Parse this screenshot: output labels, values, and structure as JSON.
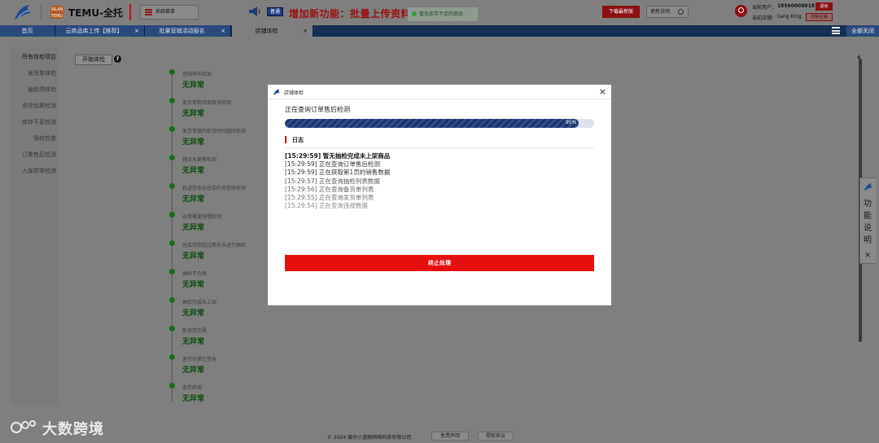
{
  "header": {
    "app_title": "TEMU-全托",
    "temu_badge": "SILAN TEMU",
    "menu_label": "系统菜单",
    "announce_tag": "普通",
    "announcement": "增加新功能：批量上传资料",
    "toast": "暂无库存不足的商品",
    "download_label": "下载最新版",
    "notes_label": "更新说明",
    "user_label": "当前用户：",
    "user_value": "18560008818",
    "store_label": "当前店铺：",
    "store_value": "liang King",
    "logout_label": "退出",
    "switch_label": "切换店铺"
  },
  "tabs": [
    {
      "label": "首页"
    },
    {
      "label": "云商品库上传【推荐】"
    },
    {
      "label": "批量营销活动报名"
    },
    {
      "label": "店铺体检"
    }
  ],
  "tab_close": "×",
  "close_all": "全部关闭",
  "sidebar": {
    "items": [
      {
        "label": "所有体检项目"
      },
      {
        "label": "发货单体检"
      },
      {
        "label": "抽检项体检"
      },
      {
        "label": "退货包裹检测"
      },
      {
        "label": "库存不足检测"
      },
      {
        "label": "侵权检查"
      },
      {
        "label": "订单售后检测"
      },
      {
        "label": "入库异常检测"
      }
    ]
  },
  "start_button": "开始体检",
  "help_symbol": "?",
  "checks": [
    {
      "label": "违规申诉检测",
      "status": "无异常"
    },
    {
      "label": "发货单物流商取消检测",
      "status": "无异常"
    },
    {
      "label": "发货单操约取货时间超时检测",
      "status": "无异常"
    },
    {
      "label": "物流未更新检测",
      "status": "无异常"
    },
    {
      "label": "轨迹签收后仓库仍未签收检测",
      "status": "无异常"
    },
    {
      "label": "运单覆盖预借检测",
      "status": "无异常"
    },
    {
      "label": "仓库到货超过两天未进行抽检",
      "status": "无异常"
    },
    {
      "label": "抽检不合格",
      "status": "无异常"
    },
    {
      "label": "抽检完成未上架",
      "status": "无异常"
    },
    {
      "label": "新退货包裹",
      "status": "无异常"
    },
    {
      "label": "退货包裹已签收",
      "status": "无异常"
    },
    {
      "label": "库存检测",
      "status": "无异常"
    }
  ],
  "help_panel": {
    "chars": [
      "功",
      "能",
      "说",
      "明"
    ],
    "close": "×"
  },
  "modal": {
    "title": "店铺体检",
    "close": "×",
    "checking": "正在查询订单售后检测",
    "progress_percent": 95,
    "progress_text": "95%",
    "log_title": "日志",
    "logs": [
      {
        "text": "[15:29:59] 暂无抽检完成未上架商品",
        "bold": true
      },
      {
        "text": "[15:29:59] 正在查询订单售后检测"
      },
      {
        "text": "[15:29:59] 正在获取第1页的销售数据"
      },
      {
        "text": "[15:29:57] 正在查询抽检列表数据"
      },
      {
        "text": "[15:29:56] 正在查询备货单列表"
      },
      {
        "text": "[15:29:55] 正在查询发货单列表"
      },
      {
        "text": "[15:29:54] 正在查询违规数据"
      }
    ],
    "stop_button": "终止处理"
  },
  "footer": {
    "copyright": "© 2024 烟台小蓝鲸网络科技有限公司",
    "disclaimer": "免责声明",
    "license": "授权协议"
  },
  "watermark": "大数跨境",
  "colors": {
    "accent_red": "#e60f0f",
    "progress_blue": "#2e4f8e",
    "tab_bar": "#172f55",
    "ok_green": "#0f4a0f"
  }
}
